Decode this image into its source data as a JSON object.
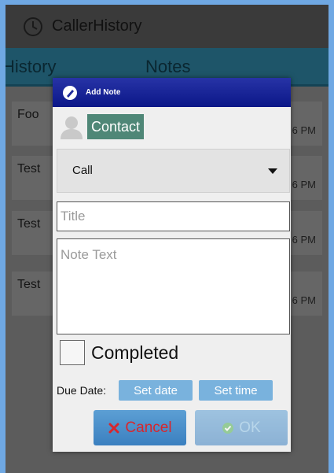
{
  "app": {
    "title": "CallerHistory",
    "icon": "phone-clock-icon"
  },
  "tabs": [
    {
      "label": "History"
    },
    {
      "label": "Notes"
    }
  ],
  "notes_list": [
    {
      "title": "Foo",
      "time": "6 PM"
    },
    {
      "title": "Test",
      "time": "6 PM"
    },
    {
      "title": "Test",
      "time": "6 PM"
    },
    {
      "title": "Test",
      "time": "6 PM"
    }
  ],
  "dialog": {
    "title": "Add Note",
    "contact_label": "Contact",
    "type_selected": "Call",
    "title_placeholder": "Title",
    "note_placeholder": "Note Text",
    "completed_label": "Completed",
    "completed_checked": false,
    "due_date_label": "Due Date:",
    "set_date_label": "Set date",
    "set_time_label": "Set time",
    "cancel_label": "Cancel",
    "ok_label": "OK"
  },
  "colors": {
    "titlebar": "#0b1788",
    "accent_blue": "#79b2dd",
    "cancel_icon": "#d9262c",
    "ok_icon": "#4caf50"
  }
}
